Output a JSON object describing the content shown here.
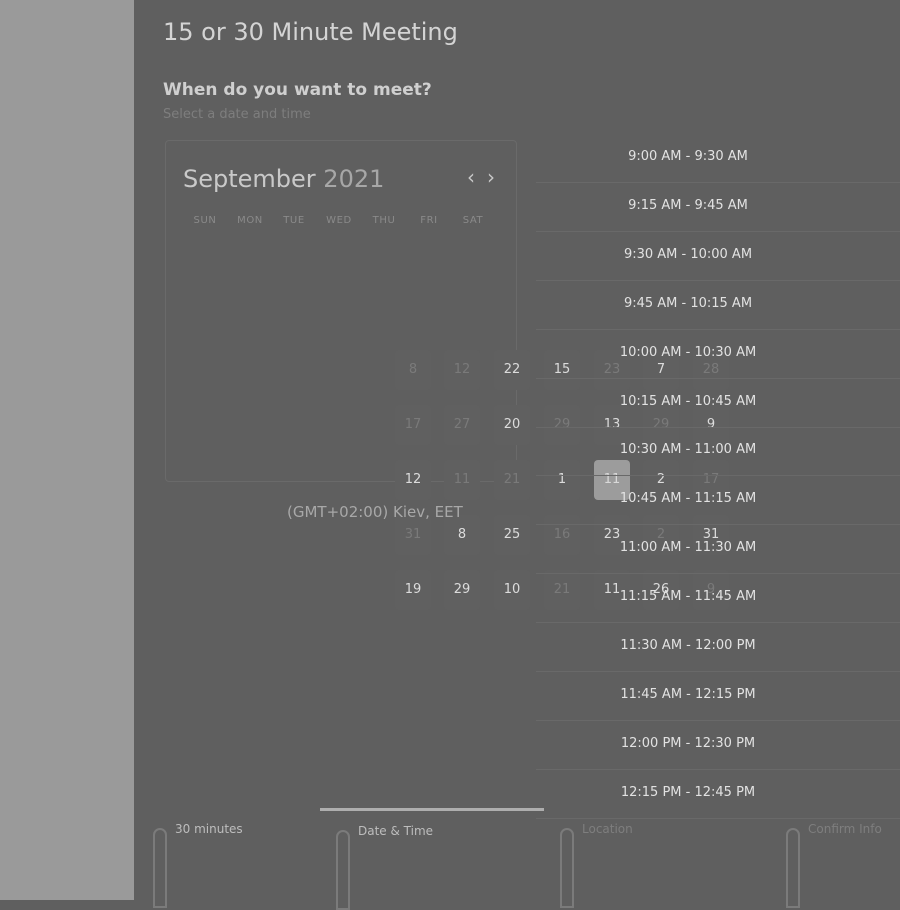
{
  "title": "15 or 30 Minute Meeting",
  "question": "When do you want to meet?",
  "subtitle": "Select a date and time",
  "calendar": {
    "month": "September",
    "year": "2021",
    "prev_label": "‹",
    "next_label": "›",
    "weekdays": [
      "SUN",
      "MON",
      "TUE",
      "WED",
      "THU",
      "FRI",
      "SAT"
    ],
    "days": [
      [
        "8",
        "12",
        "22",
        "15",
        "23",
        "7",
        "28"
      ],
      [
        "17",
        "27",
        "20",
        "29",
        "13",
        "29",
        "9"
      ],
      [
        "12",
        "11",
        "21",
        "1",
        "11",
        "2",
        "17"
      ],
      [
        "31",
        "8",
        "25",
        "16",
        "23",
        "2",
        "31"
      ],
      [
        "19",
        "29",
        "10",
        "21",
        "11",
        "26",
        "9"
      ]
    ],
    "selected": "11"
  },
  "timezone": "(GMT+02:00) Kiev, EET",
  "time_slots": [
    "9:00 AM - 9:30 AM",
    "9:15 AM - 9:45 AM",
    "9:30 AM - 10:00 AM",
    "9:45 AM - 10:15 AM",
    "10:00 AM - 10:30 AM",
    "10:15 AM - 10:45 AM",
    "10:30 AM - 11:00 AM",
    "10:45 AM - 11:15 AM",
    "11:00 AM - 11:30 AM",
    "11:15 AM - 11:45 AM",
    "11:30 AM - 12:00 PM",
    "11:45 AM - 12:15 PM",
    "12:00 PM - 12:30 PM",
    "12:15 PM - 12:45 PM"
  ],
  "steps": [
    {
      "label": "30 minutes"
    },
    {
      "label": "Date & Time"
    },
    {
      "label": "Location"
    },
    {
      "label": "Confirm Info"
    }
  ]
}
